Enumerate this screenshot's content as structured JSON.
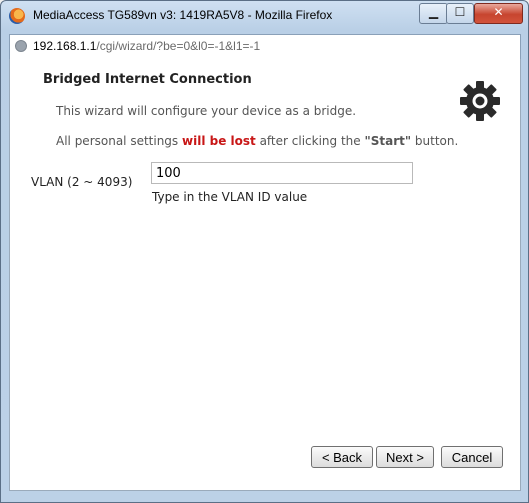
{
  "window": {
    "title": "MediaAccess TG589vn v3:  1419RA5V8 - Mozilla Firefox",
    "controls": {
      "minimize": "▁",
      "maximize": "☐",
      "close": "✕"
    }
  },
  "address": {
    "host": "192.168.1.1",
    "path": "/cgi/wizard/?be=0&l0=-1&l1=-1"
  },
  "wizard": {
    "heading": "Bridged Internet Connection",
    "intro": "This wizard will configure your device as a bridge.",
    "warning_pre": "All personal settings ",
    "warning_emph": "will be lost",
    "warning_mid": " after clicking the ",
    "warning_start": "\"Start\"",
    "warning_post": " button.",
    "vlan_label": "VLAN (2 ~ 4093)",
    "vlan_value": "100",
    "vlan_hint": "Type in the VLAN ID value"
  },
  "buttons": {
    "back": "< Back",
    "next": "Next >",
    "cancel": "Cancel"
  },
  "icons": {
    "app": "firefox-icon",
    "site": "globe-icon",
    "settings": "gear-icon"
  }
}
